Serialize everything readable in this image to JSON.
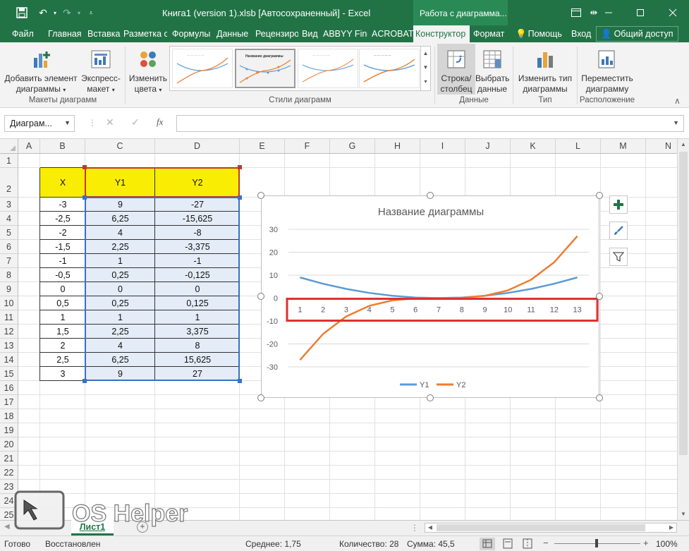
{
  "window": {
    "doc_title": "Книга1 (version 1).xlsb [Автосохраненный] - Excel",
    "context_group": "Работа с диаграмма...",
    "controls": [
      "minimize-icon",
      "restore-icon",
      "close-icon"
    ]
  },
  "tabs": [
    "Файл",
    "Главная",
    "Вставка",
    "Разметка с",
    "Формулы",
    "Данные",
    "Рецензиро",
    "Вид",
    "ABBYY Fine",
    "ACROBAT",
    "Конструктор",
    "Формат"
  ],
  "tell_me": "Помощь",
  "sign_in": "Вход",
  "share": "Общий доступ",
  "ribbon": {
    "add_element": [
      "Добавить элемент",
      "диаграммы"
    ],
    "quick_layout": [
      "Экспресс-",
      "макет"
    ],
    "change_colors": [
      "Изменить",
      "цвета"
    ],
    "switch_rowcol": [
      "Строка/",
      "столбец"
    ],
    "select_data": [
      "Выбрать",
      "данные"
    ],
    "change_type": [
      "Изменить тип",
      "диаграммы"
    ],
    "move_chart": [
      "Переместить",
      "диаграмму"
    ],
    "groups": {
      "layouts": "Макеты диаграмм",
      "styles": "Стили диаграмм",
      "data": "Данные",
      "type": "Тип",
      "location": "Расположение"
    },
    "style_thumb_title": "Название диаграммы"
  },
  "formula_bar": {
    "name_box": "Диаграм...",
    "fx": "fx",
    "value": ""
  },
  "columns": [
    "A",
    "B",
    "C",
    "D",
    "E",
    "F",
    "G",
    "H",
    "I",
    "J",
    "K",
    "L",
    "M",
    "N"
  ],
  "rows": [
    "1",
    "2",
    "3",
    "4",
    "5",
    "6",
    "7",
    "8",
    "9",
    "10",
    "11",
    "12",
    "13",
    "14",
    "15",
    "16",
    "17",
    "18",
    "19",
    "20",
    "21",
    "22",
    "23",
    "24",
    "25"
  ],
  "table": {
    "headers": [
      "X",
      "Y1",
      "Y2"
    ],
    "rows": [
      [
        "-3",
        "9",
        "-27"
      ],
      [
        "-2,5",
        "6,25",
        "-15,625"
      ],
      [
        "-2",
        "4",
        "-8"
      ],
      [
        "-1,5",
        "2,25",
        "-3,375"
      ],
      [
        "-1",
        "1",
        "-1"
      ],
      [
        "-0,5",
        "0,25",
        "-0,125"
      ],
      [
        "0",
        "0",
        "0"
      ],
      [
        "0,5",
        "0,25",
        "0,125"
      ],
      [
        "1",
        "1",
        "1"
      ],
      [
        "1,5",
        "2,25",
        "3,375"
      ],
      [
        "2",
        "4",
        "8"
      ],
      [
        "2,5",
        "6,25",
        "15,625"
      ],
      [
        "3",
        "9",
        "27"
      ]
    ]
  },
  "chart_data": {
    "type": "line",
    "title": "Название диаграммы",
    "categories": [
      "1",
      "2",
      "3",
      "4",
      "5",
      "6",
      "7",
      "8",
      "9",
      "10",
      "11",
      "12",
      "13"
    ],
    "series": [
      {
        "name": "Y1",
        "color": "#5b9bd5",
        "values": [
          9,
          6.25,
          4,
          2.25,
          1,
          0.25,
          0,
          0.25,
          1,
          2.25,
          4,
          6.25,
          9
        ]
      },
      {
        "name": "Y2",
        "color": "#ed7d31",
        "values": [
          -27,
          -15.625,
          -8,
          -3.375,
          -1,
          -0.125,
          0,
          0.125,
          1,
          3.375,
          8,
          15.625,
          27
        ]
      }
    ],
    "ylim": [
      -30,
      30
    ],
    "yticks": [
      "30",
      "20",
      "10",
      "0",
      "-10",
      "-20",
      "-30"
    ],
    "ytick_values": [
      30,
      20,
      10,
      0,
      -10,
      -20,
      -30
    ],
    "grid": true,
    "legend": "bottom",
    "highlight_color": "#e03131"
  },
  "sheet_tab": "Лист1",
  "status": {
    "ready": "Готово",
    "recovered": "Восстановлен",
    "average": "Среднее: 1,75",
    "count": "Количество: 28",
    "sum": "Сумма: 45,5",
    "zoom": "100%"
  },
  "watermark": "OS Helper",
  "colors": {
    "brand": "#217346",
    "header_fill": "#f9ed04",
    "selection_fill": "#e3ecf7"
  }
}
